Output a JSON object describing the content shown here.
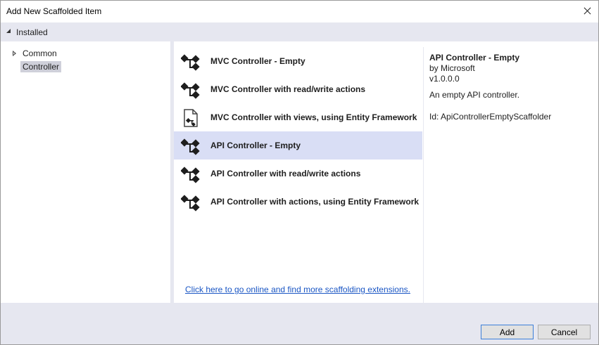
{
  "window": {
    "title": "Add New Scaffolded Item"
  },
  "installed": {
    "label": "Installed"
  },
  "tree": {
    "common": "Common",
    "controller": "Controller"
  },
  "templates": [
    {
      "label": "MVC Controller - Empty",
      "icon": "controller-icon"
    },
    {
      "label": "MVC Controller with read/write actions",
      "icon": "controller-icon"
    },
    {
      "label": "MVC Controller with views, using Entity Framework",
      "icon": "view-document-icon"
    },
    {
      "label": "API Controller - Empty",
      "icon": "controller-icon",
      "selected": true
    },
    {
      "label": "API Controller with read/write actions",
      "icon": "controller-icon"
    },
    {
      "label": "API Controller with actions, using Entity Framework",
      "icon": "controller-icon"
    }
  ],
  "online_link": "Click here to go online and find more scaffolding extensions.",
  "details": {
    "name": "API Controller - Empty",
    "author": "by Microsoft",
    "version": "v1.0.0.0",
    "description": "An empty API controller.",
    "id": "Id: ApiControllerEmptyScaffolder"
  },
  "buttons": {
    "add": "Add",
    "cancel": "Cancel"
  },
  "colors": {
    "selection": "#d9def5",
    "chrome": "#e6e7f0",
    "link": "#1a56c4"
  }
}
